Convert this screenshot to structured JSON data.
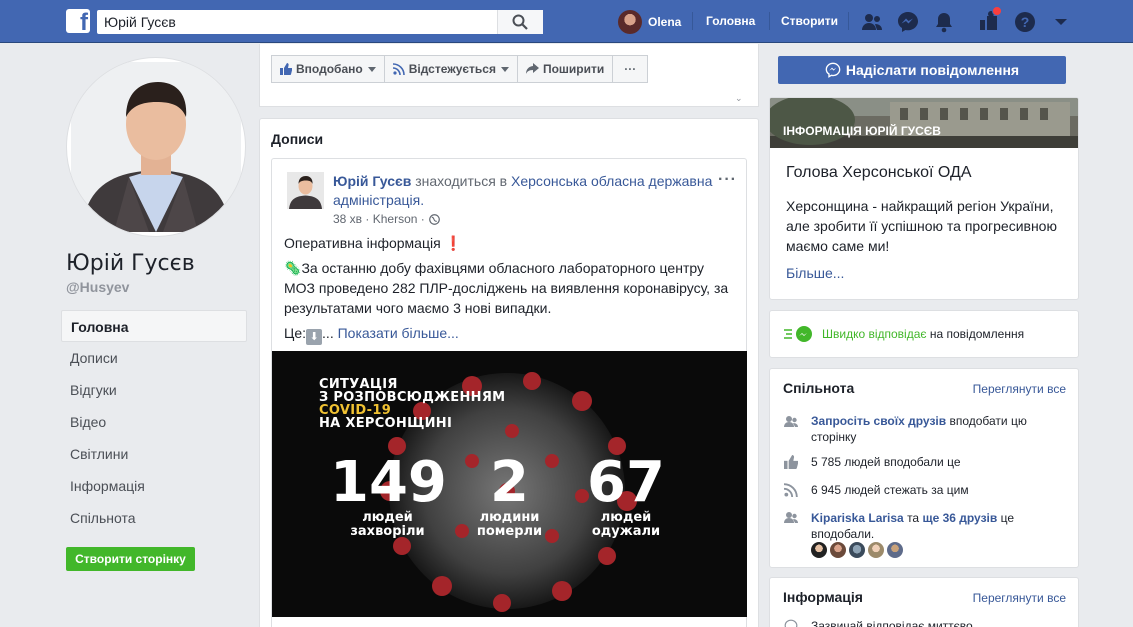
{
  "topbar": {
    "search_value": "Юрій Гусєв",
    "user_name": "Olena",
    "nav_home": "Головна",
    "nav_create": "Створити",
    "icons": [
      "friends-icon",
      "messenger-icon",
      "notifications-icon",
      "page-icon",
      "help-icon",
      "caret-down-icon"
    ]
  },
  "profile": {
    "name": "Юрій Гусєв",
    "handle": "@Husyev"
  },
  "left_nav": {
    "items": [
      {
        "label": "Головна"
      },
      {
        "label": "Дописи"
      },
      {
        "label": "Відгуки"
      },
      {
        "label": "Відео"
      },
      {
        "label": "Світлини"
      },
      {
        "label": "Інформація"
      },
      {
        "label": "Спільнота"
      }
    ],
    "create_page": "Створити сторінку"
  },
  "actions": {
    "like": "Вподобано",
    "follow": "Відстежується",
    "share": "Поширити",
    "more": "···",
    "send_message": "Надіслати повідомлення"
  },
  "posts": {
    "title": "Дописи",
    "post": {
      "author": "Юрій Гусєв",
      "is_at": "знаходиться в",
      "place": "Херсонська обласна державна адміністрація.",
      "time": "38 хв",
      "location": "Kherson",
      "line1": "Оперативна інформація",
      "line2": "За останню добу фахівцями обласного лабораторного центру МОЗ проведено 282 ПЛР-досліджень на виявлення коронавірусу, за результатами чого маємо 3 нові випадки.",
      "line3_prefix": "Це:",
      "show_more": "Показати більше..."
    },
    "image": {
      "title_1": "СИТУАЦІЯ",
      "title_2": "З РОЗПОВСЮДЖЕННЯМ",
      "title_3": "COVID-19",
      "title_4": "НА ХЕРСОНЩИНІ",
      "stats": [
        {
          "value": "149",
          "label_1": "людей",
          "label_2": "захворіли"
        },
        {
          "value": "2",
          "label_1": "людини",
          "label_2": "померли"
        },
        {
          "value": "67",
          "label_1": "людей",
          "label_2": "одужали"
        }
      ]
    }
  },
  "info": {
    "banner": "ІНФОРМАЦІЯ ЮРІЙ ГУСЄВ",
    "headline": "Голова Херсонської ОДА",
    "description": "Херсонщина - найкращий регіон України, але зробити її успішною та прогресивною маємо саме ми!",
    "more": "Більше..."
  },
  "response": {
    "fast": "Швидко відповідає",
    "rest": "на повідомлення"
  },
  "community": {
    "title": "Спільнота",
    "see_all": "Переглянути все",
    "invite_link": "Запросіть своїх друзів",
    "invite_rest": "вподобати цю сторінку",
    "likes": "5 785 людей вподобали це",
    "follows": "6 945 людей стежать за цим",
    "friend_name": "Kipariska Larisa",
    "friend_and": "та",
    "friend_more": "ще 36 друзів",
    "friend_rest": "це вподобали."
  },
  "info2": {
    "title": "Інформація",
    "see_all": "Переглянути все",
    "sub": "Зазвичай відповідає миттєво"
  },
  "colors": {
    "brand": "#4267b2",
    "link": "#385898",
    "green": "#42b72a",
    "background": "#e9ebee"
  }
}
